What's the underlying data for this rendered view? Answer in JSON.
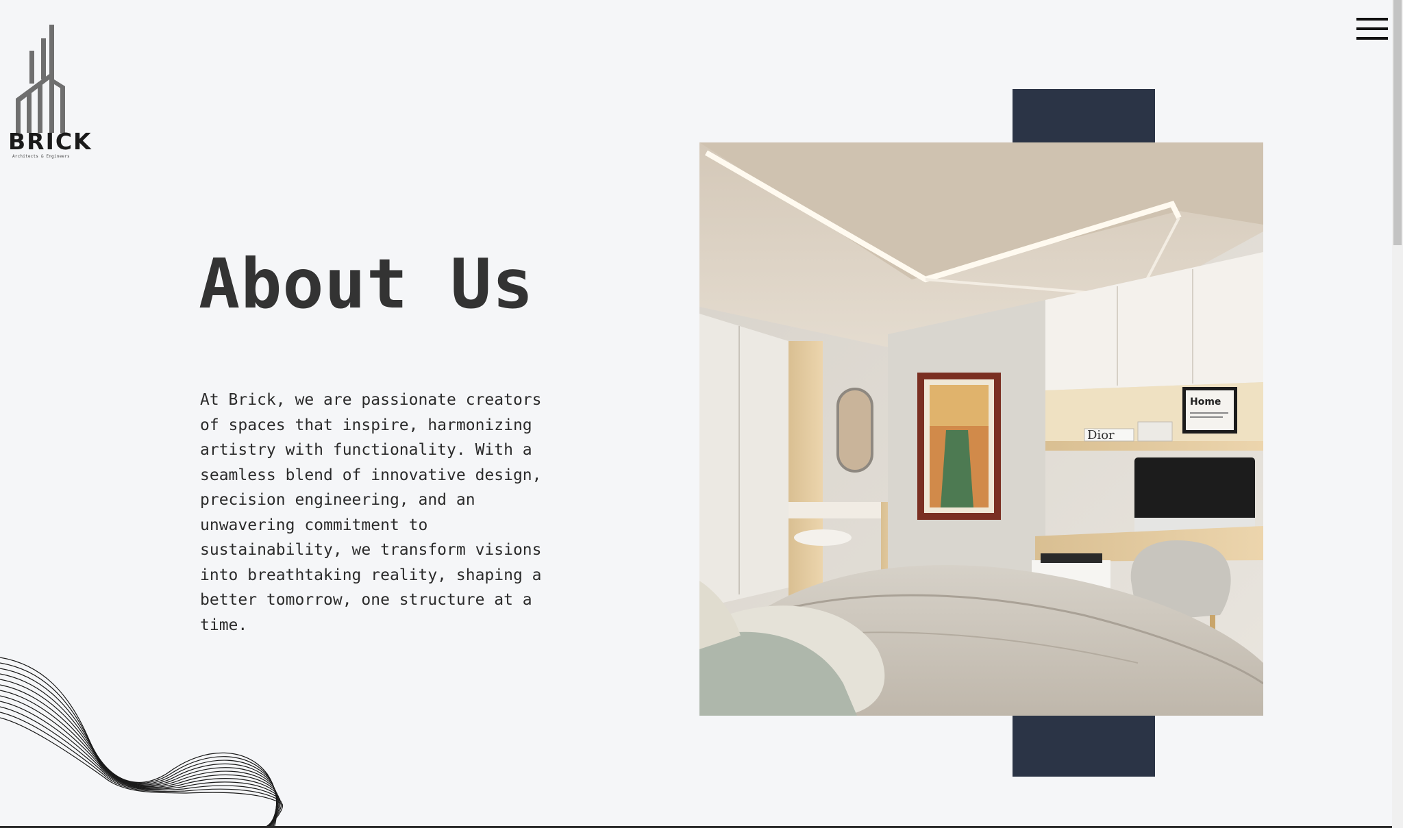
{
  "logo": {
    "word": "BRICK",
    "tagline": "Architects & Engineers",
    "icon": "building-logo-icon"
  },
  "menu": {
    "icon": "hamburger-menu-icon"
  },
  "about": {
    "title": "About Us",
    "body": "At Brick, we are passionate creators of spaces that inspire, harmonizing artistry with functionality. With a seamless blend of innovative design, precision engineering, and an unwavering commitment to sustainability, we transform visions into breathtaking reality, shaping a better tomorrow, one structure at a time."
  },
  "image": {
    "poster_label": "Home",
    "book_label": "Dior"
  },
  "colors": {
    "background": "#f5f6f8",
    "accent_navy": "#2b3446",
    "text": "#2f2f2f"
  }
}
